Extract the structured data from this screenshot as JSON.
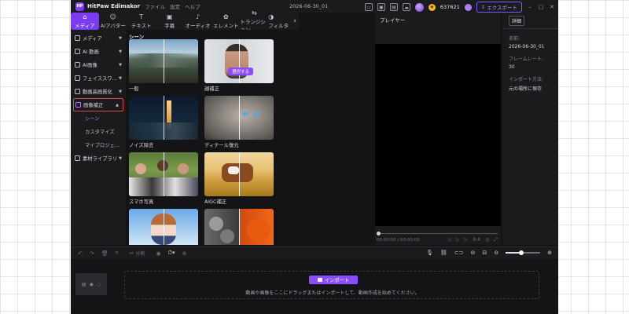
{
  "app": {
    "logo_text": "HP",
    "name": "HitPaw Edimakor",
    "menu": [
      "ファイル",
      "設定",
      "ヘルプ"
    ],
    "document_title": "2026-06-30_01",
    "coins": "637621",
    "export_label": "エクスポート",
    "accent": "#7a3cf0"
  },
  "toolbar": {
    "items": [
      {
        "label": "メディア",
        "icon": "media-icon"
      },
      {
        "label": "AIアバター",
        "icon": "avatar-icon"
      },
      {
        "label": "テキスト",
        "icon": "text-icon"
      },
      {
        "label": "字幕",
        "icon": "subtitle-icon"
      },
      {
        "label": "オーディオ",
        "icon": "audio-icon"
      },
      {
        "label": "エレメント",
        "icon": "element-icon"
      },
      {
        "label": "トランジション",
        "icon": "transition-icon"
      },
      {
        "label": "フィルタ",
        "icon": "filter-icon"
      }
    ],
    "active": "メディア"
  },
  "sidebar": {
    "items": [
      {
        "label": "メディア"
      },
      {
        "label": "AI 動画"
      },
      {
        "label": "AI画像"
      },
      {
        "label": "フェイススワ…"
      },
      {
        "label": "動画高画質化"
      },
      {
        "label": "画像補正"
      }
    ],
    "sub_items": [
      {
        "label": "シーン"
      },
      {
        "label": "カスタマイズ"
      },
      {
        "label": "マイプロジェ…"
      }
    ],
    "library_item": {
      "label": "素材ライブラリ"
    }
  },
  "library": {
    "heading": "シーン",
    "cards": [
      {
        "label": "一般"
      },
      {
        "label": "顔補正",
        "button": "選択する"
      },
      {
        "label": "ノイズ除去"
      },
      {
        "label": "ディテール復元"
      },
      {
        "label": "スマホ写真"
      },
      {
        "label": "AIGC補正"
      },
      {
        "label": ""
      },
      {
        "label": ""
      }
    ]
  },
  "player": {
    "title": "プレイヤー",
    "time": "00:00:00 / 00:00:00",
    "ratio": "9:4"
  },
  "details": {
    "tab": "詳細",
    "fields": [
      {
        "label": "名前:",
        "value": "2026-06-30_01"
      },
      {
        "label": "フレームレート:",
        "value": "30"
      },
      {
        "label": "インポート方法:",
        "value": "元の場所に保存"
      }
    ]
  },
  "edit_bar": {
    "split_label": "分割",
    "zoom_level": 0.45
  },
  "timeline": {
    "import_label": "インポート",
    "hint": "動画や画像をここにドラッグまたはインポートして、動画作成を始めてください。"
  }
}
